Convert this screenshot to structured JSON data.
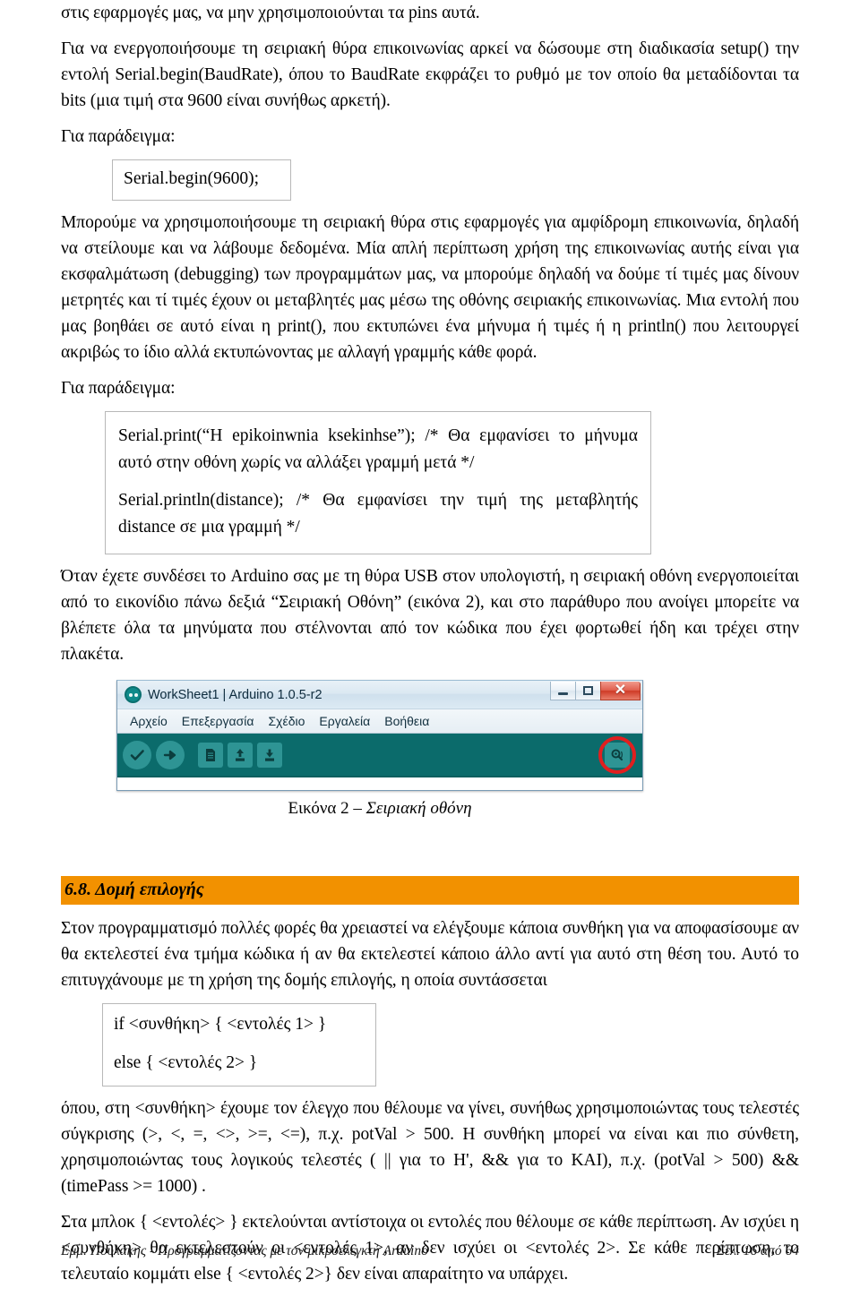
{
  "document": {
    "paragraphs": {
      "p1": "στις εφαρμογές μας, να μην χρησιμοποιούνται τα pins αυτά.",
      "p2": "Για να ενεργοποιήσουμε τη σειριακή θύρα επικοινωνίας αρκεί να δώσουμε στη διαδικασία setup() την εντολή Serial.begin(BaudRate), όπου το BaudRate εκφράζει το ρυθμό με τον οποίο θα μεταδίδονται τα bits (μια τιμή στα 9600 είναι συνήθως αρκετή).",
      "example_label_1": "Για παράδειγμα:",
      "p3": "Μπορούμε να χρησιμοποιήσουμε τη σειριακή θύρα στις εφαρμογές για αμφίδρομη επικοινωνία, δηλαδή να στείλουμε και να λάβουμε δεδομένα. Μία απλή περίπτωση χρήση της επικοινωνίας αυτής είναι για εκσφαλμάτωση (debugging) των προγραμμάτων μας, να μπορούμε δηλαδή να δούμε τί τιμές μας δίνουν μετρητές και τί τιμές έχουν οι μεταβλητές μας μέσω της οθόνης σειριακής επικοινωνίας. Μια εντολή που μας βοηθάει σε αυτό είναι η print(), που εκτυπώνει ένα μήνυμα ή τιμές ή η println() που λειτουργεί ακριβώς το ίδιο αλλά εκτυπώνοντας με αλλαγή γραμμής κάθε φορά.",
      "example_label_2": "Για παράδειγμα:",
      "p4": "Όταν έχετε συνδέσει το Arduino σας με τη θύρα USB στον υπολογιστή, η σειριακή οθόνη ενεργοποιείται από το εικονίδιο πάνω δεξιά “Σειριακή Οθόνη” (εικόνα 2), και στο παράθυρο που ανοίγει μπορείτε να βλέπετε όλα τα μηνύματα που στέλνονται από τον κώδικα που έχει φορτωθεί ήδη και τρέχει στην πλακέτα.",
      "p5": "Στον προγραμματισμό πολλές φορές θα χρειαστεί να ελέγξουμε κάποια συνθήκη για να αποφασίσουμε αν θα εκτελεστεί ένα τμήμα κώδικα ή αν θα εκτελεστεί κάποιο άλλο αντί για αυτό στη θέση του. Αυτό το επιτυγχάνουμε με τη χρήση της δομής επιλογής, η οποία συντάσσεται",
      "p6": "όπου, στη <συνθήκη> έχουμε τον έλεγχο που θέλουμε να γίνει, συνήθως χρησιμοποιώντας τους τελεστές σύγκρισης (>, <, =, <>, >=, <=), π.χ.  potVal > 500. Η συνθήκη μπορεί να είναι και πιο σύνθετη, χρησιμοποιώντας τους λογικούς τελεστές ( || για το Η', && για το ΚΑΙ), π.χ. (potVal > 500) && (timePass >= 1000) .",
      "p7": "Στα μπλοκ { <εντολές> } εκτελούνται αντίστοιχα οι εντολές που θέλουμε σε κάθε περίπτωση. Αν ισχύει η <συνθήκη> θα εκτελεστούν οι <εντολές 1>, αν δεν ισχύει οι <εντολές 2>. Σε κάθε περίπτωση, το τελευταίο κομμάτι else { <εντολές 2>} δεν είναι απαραίτητο να υπάρχει."
    },
    "code_boxes": {
      "serial_begin": "Serial.begin(9600);",
      "serial_print_1": "Serial.print(“H epikoinwnia ksekinhse”); /* Θα εμφανίσει το μήνυμα αυτό στην οθόνη χωρίς να αλλάξει γραμμή μετά */",
      "serial_print_2": "Serial.println(distance); /* Θα εμφανίσει την τιμή της μεταβλητής distance σε μια γραμμή */",
      "if_line": "if <συνθήκη> { <εντολές 1> }",
      "else_line": "else { <εντολές 2> }"
    },
    "section_heading": "6.8. Δομή επιλογής",
    "figure_caption": {
      "prefix": "Εικόνα 2 – ",
      "italic": "Σειριακή οθόνη"
    },
    "footer": {
      "left": "Εμμ. Πουλάκης - Προγραμματίζοντας με τον μικροελεγκτή Arduino",
      "right": "Σελ. 16 από 64"
    }
  },
  "arduino_ide": {
    "title": "WorkSheet1 | Arduino 1.0.5-r2",
    "menu_items": [
      "Αρχείο",
      "Επεξεργασία",
      "Σχέδιο",
      "Εργαλεία",
      "Βοήθεια"
    ],
    "toolbar_icons": [
      "verify-checkmark-icon",
      "upload-arrow-icon",
      "new-sketch-icon",
      "open-sketch-icon",
      "save-sketch-icon",
      "serial-monitor-icon"
    ],
    "window_controls": {
      "minimize": "minimize-button",
      "maximize": "maximize-button",
      "close_label": "✕"
    },
    "colors": {
      "toolbar_bg": "#0b6b6b",
      "icon_bg": "#2e9494",
      "highlight_ring": "#e11f1f",
      "heading_bg": "#f29100"
    }
  }
}
